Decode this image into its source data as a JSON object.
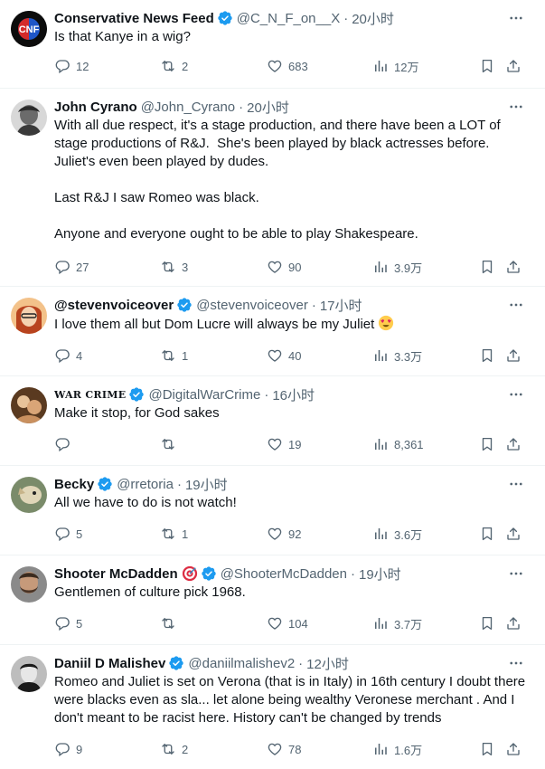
{
  "tweets": [
    {
      "name": "Conservative News Feed",
      "handle": "@C_N_F_on__X",
      "sep": "·",
      "time": "20小时",
      "text": "Is that Kanye in a wig?",
      "replies": "12",
      "retweets": "2",
      "likes": "683",
      "views": "12万",
      "verified": true,
      "avatar_text": "CNF"
    },
    {
      "name": "John Cyrano",
      "handle": "@John_Cyrano",
      "sep": "·",
      "time": "20小时",
      "text": "With all due respect, it's a stage production, and there have been a LOT of stage productions of R&J.  She's been played by black actresses before. Juliet's even been played by dudes.\n\nLast R&J I saw Romeo was black.\n\nAnyone and everyone ought to be able to play Shakespeare.",
      "replies": "27",
      "retweets": "3",
      "likes": "90",
      "views": "3.9万",
      "verified": false
    },
    {
      "name": "@stevenvoiceover",
      "handle": "@stevenvoiceover",
      "sep": "·",
      "time": "17小时",
      "text": "I love them all but Dom Lucre will always be my Juliet",
      "emoji": "heart-eyes-emoji",
      "replies": "4",
      "retweets": "1",
      "likes": "40",
      "views": "3.3万",
      "verified": true
    },
    {
      "name": "WAR CRIME",
      "handle": "@DigitalWarCrime",
      "sep": "·",
      "time": "16小时",
      "text": "Make it stop, for God sakes",
      "replies": "",
      "retweets": "",
      "likes": "19",
      "views": "8,361",
      "verified": true
    },
    {
      "name": "Becky",
      "handle": "@rretoria",
      "sep": "·",
      "time": "19小时",
      "text": "All we have to do is not watch!",
      "replies": "5",
      "retweets": "1",
      "likes": "92",
      "views": "3.6万",
      "verified": true
    },
    {
      "name": "Shooter McDadden",
      "handle": "@ShooterMcDadden",
      "sep": "·",
      "time": "19小时",
      "text": "Gentlemen of culture pick 1968.",
      "emoji_after_name": "target-emoji",
      "replies": "5",
      "retweets": "",
      "likes": "104",
      "views": "3.7万",
      "verified": true
    },
    {
      "name": "Daniil D Malishev",
      "handle": "@daniilmalishev2",
      "sep": "·",
      "time": "12小时",
      "text": "Romeo and Juliet is set on Verona (that is in Italy) in 16th century I doubt there were blacks even as sla... let alone being wealthy Veronese merchant . And I don't meant to be racist here. History can't be changed by trends",
      "replies": "9",
      "retweets": "2",
      "likes": "78",
      "views": "1.6万",
      "verified": true
    }
  ],
  "colors": {
    "verified": "#1d9bf0",
    "meta": "#536471",
    "text": "#0f1419",
    "divider": "#eff3f4"
  },
  "icons": [
    "reply-icon",
    "retweet-icon",
    "like-icon",
    "views-icon",
    "bookmark-icon",
    "share-icon",
    "more-icon",
    "verified-icon"
  ]
}
